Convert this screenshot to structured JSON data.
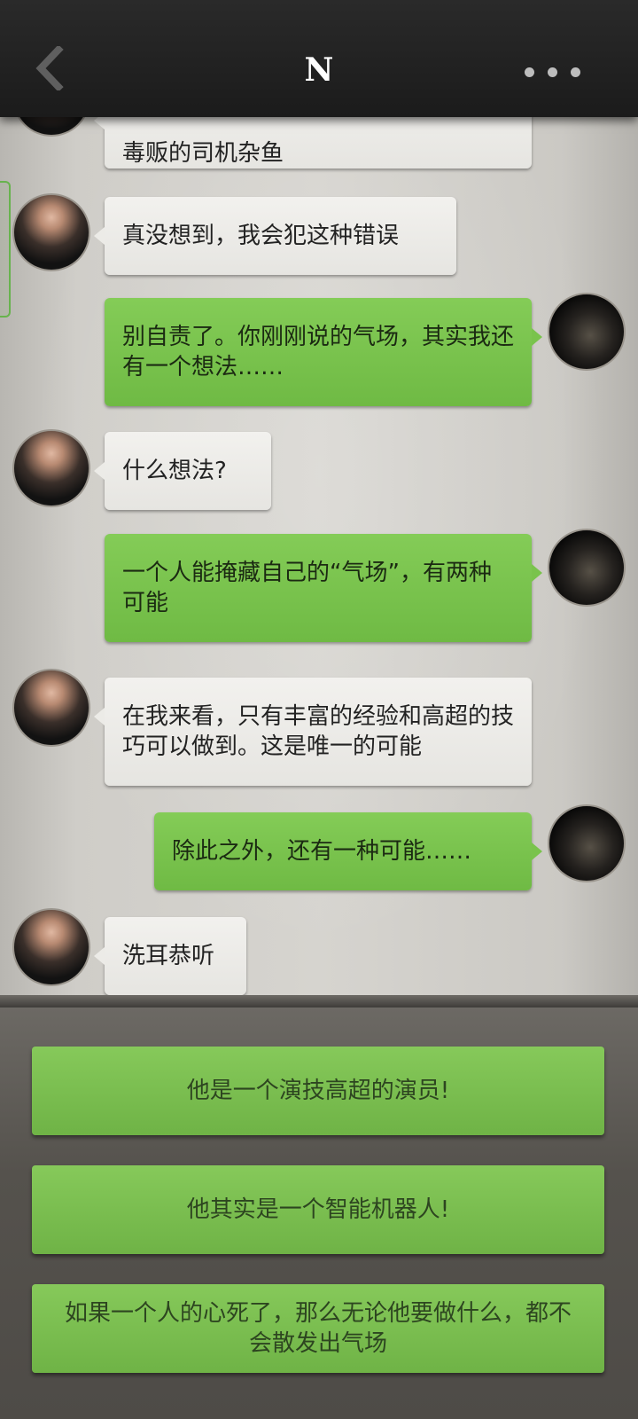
{
  "header": {
    "title": "N"
  },
  "messages": [
    {
      "side": "left",
      "text": "毒贩的司机杂鱼"
    },
    {
      "side": "left",
      "text": "真没想到，我会犯这种错误"
    },
    {
      "side": "right",
      "text": "别自责了。你刚刚说的气场，其实我还有一个想法……"
    },
    {
      "side": "left",
      "text": "什么想法?"
    },
    {
      "side": "right",
      "text": "一个人能掩藏自己的“气场”，有两种可能"
    },
    {
      "side": "left",
      "text": "在我来看，只有丰富的经验和高超的技巧可以做到。这是唯一的可能"
    },
    {
      "side": "right",
      "text": "除此之外，还有一种可能……"
    },
    {
      "side": "left",
      "text": "洗耳恭听"
    }
  ],
  "options": [
    {
      "text": "他是一个演技高超的演员!"
    },
    {
      "text": "他其实是一个智能机器人!"
    },
    {
      "text": "如果一个人的心死了，那么无论他要做什么，都不会散发出气场"
    }
  ]
}
